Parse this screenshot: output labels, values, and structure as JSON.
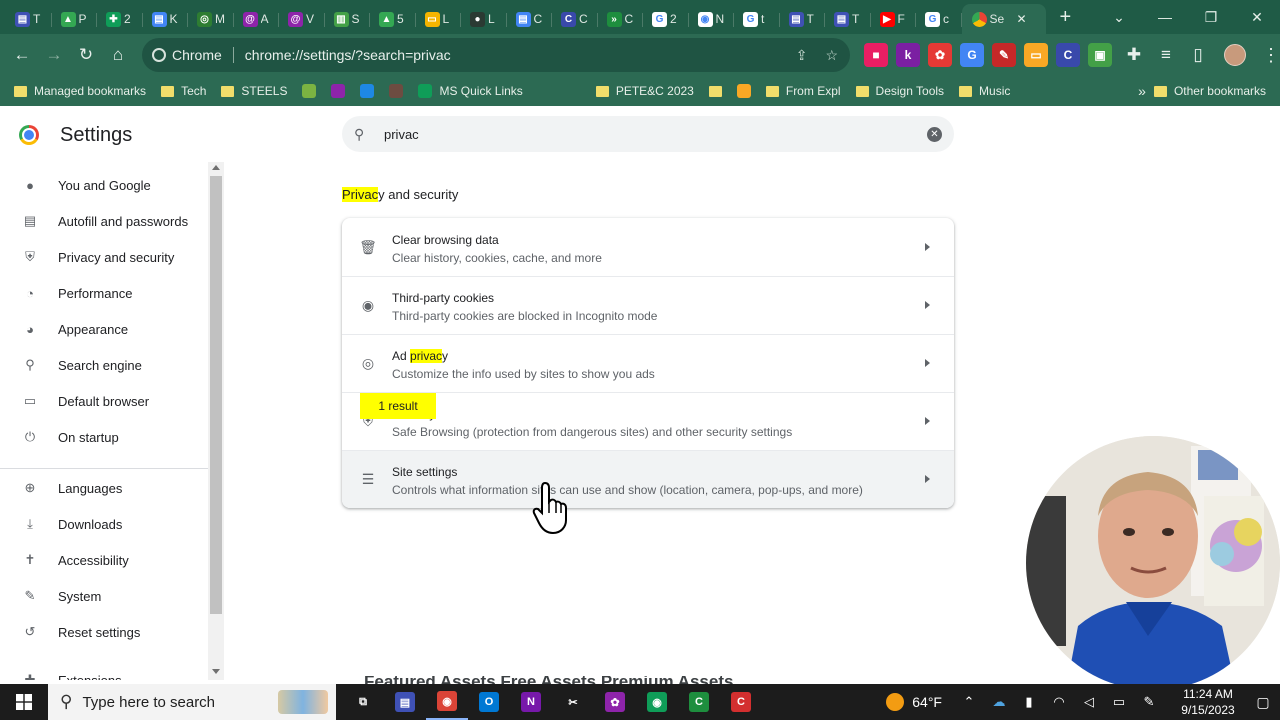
{
  "tabs": [
    {
      "icon": "tasks-icon",
      "color": "#3f51b5",
      "glyph": "▤",
      "label": "T"
    },
    {
      "icon": "drive-icon",
      "color": "#34a853",
      "glyph": "▲",
      "label": "P"
    },
    {
      "icon": "sheets-icon",
      "color": "#0f9d58",
      "glyph": "✚",
      "label": "2"
    },
    {
      "icon": "docs-icon",
      "color": "#4285f4",
      "glyph": "▤",
      "label": "K"
    },
    {
      "icon": "circle-app-icon",
      "color": "#2e7d32",
      "glyph": "◎",
      "label": "M"
    },
    {
      "icon": "swirl-icon",
      "color": "#8e24aa",
      "glyph": "@",
      "label": "A"
    },
    {
      "icon": "swirl-icon",
      "color": "#8e24aa",
      "glyph": "@",
      "label": "V"
    },
    {
      "icon": "chart-icon",
      "color": "#43a047",
      "glyph": "▥",
      "label": "S"
    },
    {
      "icon": "drive-icon",
      "color": "#34a853",
      "glyph": "▲",
      "label": "5"
    },
    {
      "icon": "slides-icon",
      "color": "#f4b400",
      "glyph": "▭",
      "label": "L"
    },
    {
      "icon": "github-icon",
      "color": "#2b3a33",
      "glyph": "●",
      "label": "L"
    },
    {
      "icon": "docs-icon",
      "color": "#4285f4",
      "glyph": "▤",
      "label": "C"
    },
    {
      "icon": "c-icon",
      "color": "#3949ab",
      "glyph": "C",
      "label": "C"
    },
    {
      "icon": "forward-app-icon",
      "color": "#1e8e3e",
      "glyph": "»",
      "label": "C"
    },
    {
      "icon": "google-icon",
      "color": "#ffffff",
      "glyph": "G",
      "label": "2"
    },
    {
      "icon": "chrome-icon",
      "color": "#ffffff",
      "glyph": "◉",
      "label": "N"
    },
    {
      "icon": "google-icon",
      "color": "#ffffff",
      "glyph": "G",
      "label": "t"
    },
    {
      "icon": "tasks-icon",
      "color": "#3f51b5",
      "glyph": "▤",
      "label": "T"
    },
    {
      "icon": "tasks-icon",
      "color": "#3f51b5",
      "glyph": "▤",
      "label": "T"
    },
    {
      "icon": "youtube-icon",
      "color": "#ff0000",
      "glyph": "▶",
      "label": "F"
    },
    {
      "icon": "google-icon",
      "color": "#ffffff",
      "glyph": "G",
      "label": "c"
    }
  ],
  "active_tab": {
    "label": "Se",
    "close": "✕"
  },
  "new_tab": "+",
  "window_controls": {
    "dropdown": "⌄",
    "minimize": "—",
    "restore": "❐",
    "close": "✕"
  },
  "omnibox": {
    "site_label": "Chrome",
    "url": "chrome://settings/?search=privac"
  },
  "extensions": [
    {
      "name": "video-ext-icon",
      "color": "#e91e63",
      "glyph": "■"
    },
    {
      "name": "kami-ext-icon",
      "color": "#7b1fa2",
      "glyph": "k"
    },
    {
      "name": "colorful-ext-icon",
      "color": "#e53935",
      "glyph": "✿"
    },
    {
      "name": "translate-ext-icon",
      "color": "#4285f4",
      "glyph": "G"
    },
    {
      "name": "pen-ext-icon",
      "color": "#c62828",
      "glyph": "✎"
    },
    {
      "name": "highlighter-ext-icon",
      "color": "#f9a825",
      "glyph": "▭"
    },
    {
      "name": "c-ext-icon",
      "color": "#3949ab",
      "glyph": "C"
    },
    {
      "name": "screen-ext-icon",
      "color": "#43a047",
      "glyph": "▣"
    }
  ],
  "bookmarks": [
    {
      "kind": "folder",
      "label": "Managed bookmarks"
    },
    {
      "kind": "folder",
      "label": "Tech"
    },
    {
      "kind": "folder",
      "label": "STEELS"
    },
    {
      "kind": "icon",
      "icon": "picture-bm-icon",
      "color": "#7cb342",
      "label": ""
    },
    {
      "kind": "icon",
      "icon": "s-bm-icon",
      "color": "#8e24aa",
      "label": ""
    },
    {
      "kind": "icon",
      "icon": "puzzle-bm-icon",
      "color": "#1e88e5",
      "label": ""
    },
    {
      "kind": "icon",
      "icon": "photo-bm-icon",
      "color": "#6d4c41",
      "label": ""
    },
    {
      "kind": "icon",
      "icon": "plus-bm-icon",
      "color": "#0f9d58",
      "label": "MS Quick Links"
    },
    {
      "kind": "icon",
      "icon": "openai-bm-icon",
      "color": "#2c6a53",
      "label": ""
    },
    {
      "kind": "icon",
      "icon": "globe-bm-icon",
      "color": "#2c6a53",
      "label": ""
    },
    {
      "kind": "folder",
      "label": "PETE&C 2023"
    },
    {
      "kind": "folder",
      "label": ""
    },
    {
      "kind": "icon",
      "icon": "emoji-bm-icon",
      "color": "#f9a825",
      "label": ""
    },
    {
      "kind": "folder",
      "label": "From Expl"
    },
    {
      "kind": "folder",
      "label": "Design Tools"
    },
    {
      "kind": "folder",
      "label": "Music"
    }
  ],
  "bookmarks_more": "»",
  "bookmarks_other": "Other bookmarks",
  "settings": {
    "title": "Settings",
    "search_value": "privac",
    "section_title_highlight": "Privac",
    "section_title_rest": "y and security"
  },
  "sidebar": [
    {
      "icon": "person-icon",
      "glyph": "●",
      "label": "You and Google"
    },
    {
      "icon": "clipboard-icon",
      "glyph": "▤",
      "label": "Autofill and passwords"
    },
    {
      "icon": "shield-icon",
      "glyph": "⛨",
      "label": "Privacy and security"
    },
    {
      "icon": "speedometer-icon",
      "glyph": "◔",
      "label": "Performance"
    },
    {
      "icon": "palette-icon",
      "glyph": "◕",
      "label": "Appearance"
    },
    {
      "icon": "search-icon",
      "glyph": "⚲",
      "label": "Search engine"
    },
    {
      "icon": "browser-icon",
      "glyph": "▭",
      "label": "Default browser"
    },
    {
      "icon": "power-icon",
      "glyph": "⏻",
      "label": "On startup"
    },
    {
      "icon": "globe-icon",
      "glyph": "⊕",
      "label": "Languages"
    },
    {
      "icon": "download-icon",
      "glyph": "⤓",
      "label": "Downloads"
    },
    {
      "icon": "accessibility-icon",
      "glyph": "✝",
      "label": "Accessibility"
    },
    {
      "icon": "wrench-icon",
      "glyph": "✎",
      "label": "System"
    },
    {
      "icon": "reset-icon",
      "glyph": "↺",
      "label": "Reset settings"
    },
    {
      "icon": "extensions-icon",
      "glyph": "✚",
      "label": "Extensions"
    }
  ],
  "rows": [
    {
      "icon": "trash-icon",
      "glyph": "🗑",
      "title_pre": "Clear browsing data",
      "title_hl": "",
      "title_post": "",
      "subtitle": "Clear history, cookies, cache, and more"
    },
    {
      "icon": "cookie-icon",
      "glyph": "◉",
      "title_pre": "Third-party cookies",
      "title_hl": "",
      "title_post": "",
      "subtitle": "Third-party cookies are blocked in Incognito mode"
    },
    {
      "icon": "ad-privacy-icon",
      "glyph": "◎",
      "title_pre": "Ad ",
      "title_hl": "privac",
      "title_post": "y",
      "subtitle": "Customize the info used by sites to show you ads"
    },
    {
      "icon": "security-shield-icon",
      "glyph": "⛨",
      "title_pre": "Security",
      "title_hl": "",
      "title_post": "",
      "subtitle": "Safe Browsing (protection from dangerous sites) and other security settings"
    },
    {
      "icon": "tune-icon",
      "glyph": "☰",
      "title_pre": "Site settings",
      "title_hl": "",
      "title_post": "",
      "subtitle": "Controls what information sites can use and show (location, camera, pop-ups, and more)"
    }
  ],
  "result_bubble": "1 result",
  "footer_text": "Featured Assets   Free Assets   Premium Assets",
  "taskbar": {
    "search_placeholder": "Type here to search",
    "apps": [
      {
        "icon": "task-view-icon",
        "color": "#1c1c1c",
        "glyph": "⧉",
        "open": false
      },
      {
        "icon": "calendar-app-icon",
        "color": "#3f51b5",
        "glyph": "▤",
        "open": false
      },
      {
        "icon": "chrome-taskbar-icon",
        "color": "#db4437",
        "glyph": "◉",
        "open": true
      },
      {
        "icon": "outlook-icon",
        "color": "#0078d4",
        "glyph": "O",
        "open": false
      },
      {
        "icon": "onenote-icon",
        "color": "#7719aa",
        "glyph": "N",
        "open": false
      },
      {
        "icon": "snipping-icon",
        "color": "#1c1c1c",
        "glyph": "✂",
        "open": false
      },
      {
        "icon": "color-app-icon",
        "color": "#8e24aa",
        "glyph": "✿",
        "open": false
      },
      {
        "icon": "chrome-taskbar-icon-2",
        "color": "#0f9d58",
        "glyph": "◉",
        "open": false
      },
      {
        "icon": "camtasia-green-icon",
        "color": "#1e8e3e",
        "glyph": "C",
        "open": false
      },
      {
        "icon": "camtasia-red-icon",
        "color": "#d32f2f",
        "glyph": "C",
        "open": false
      }
    ],
    "weather": "64°F",
    "time": "11:24 AM",
    "date": "9/15/2023"
  }
}
